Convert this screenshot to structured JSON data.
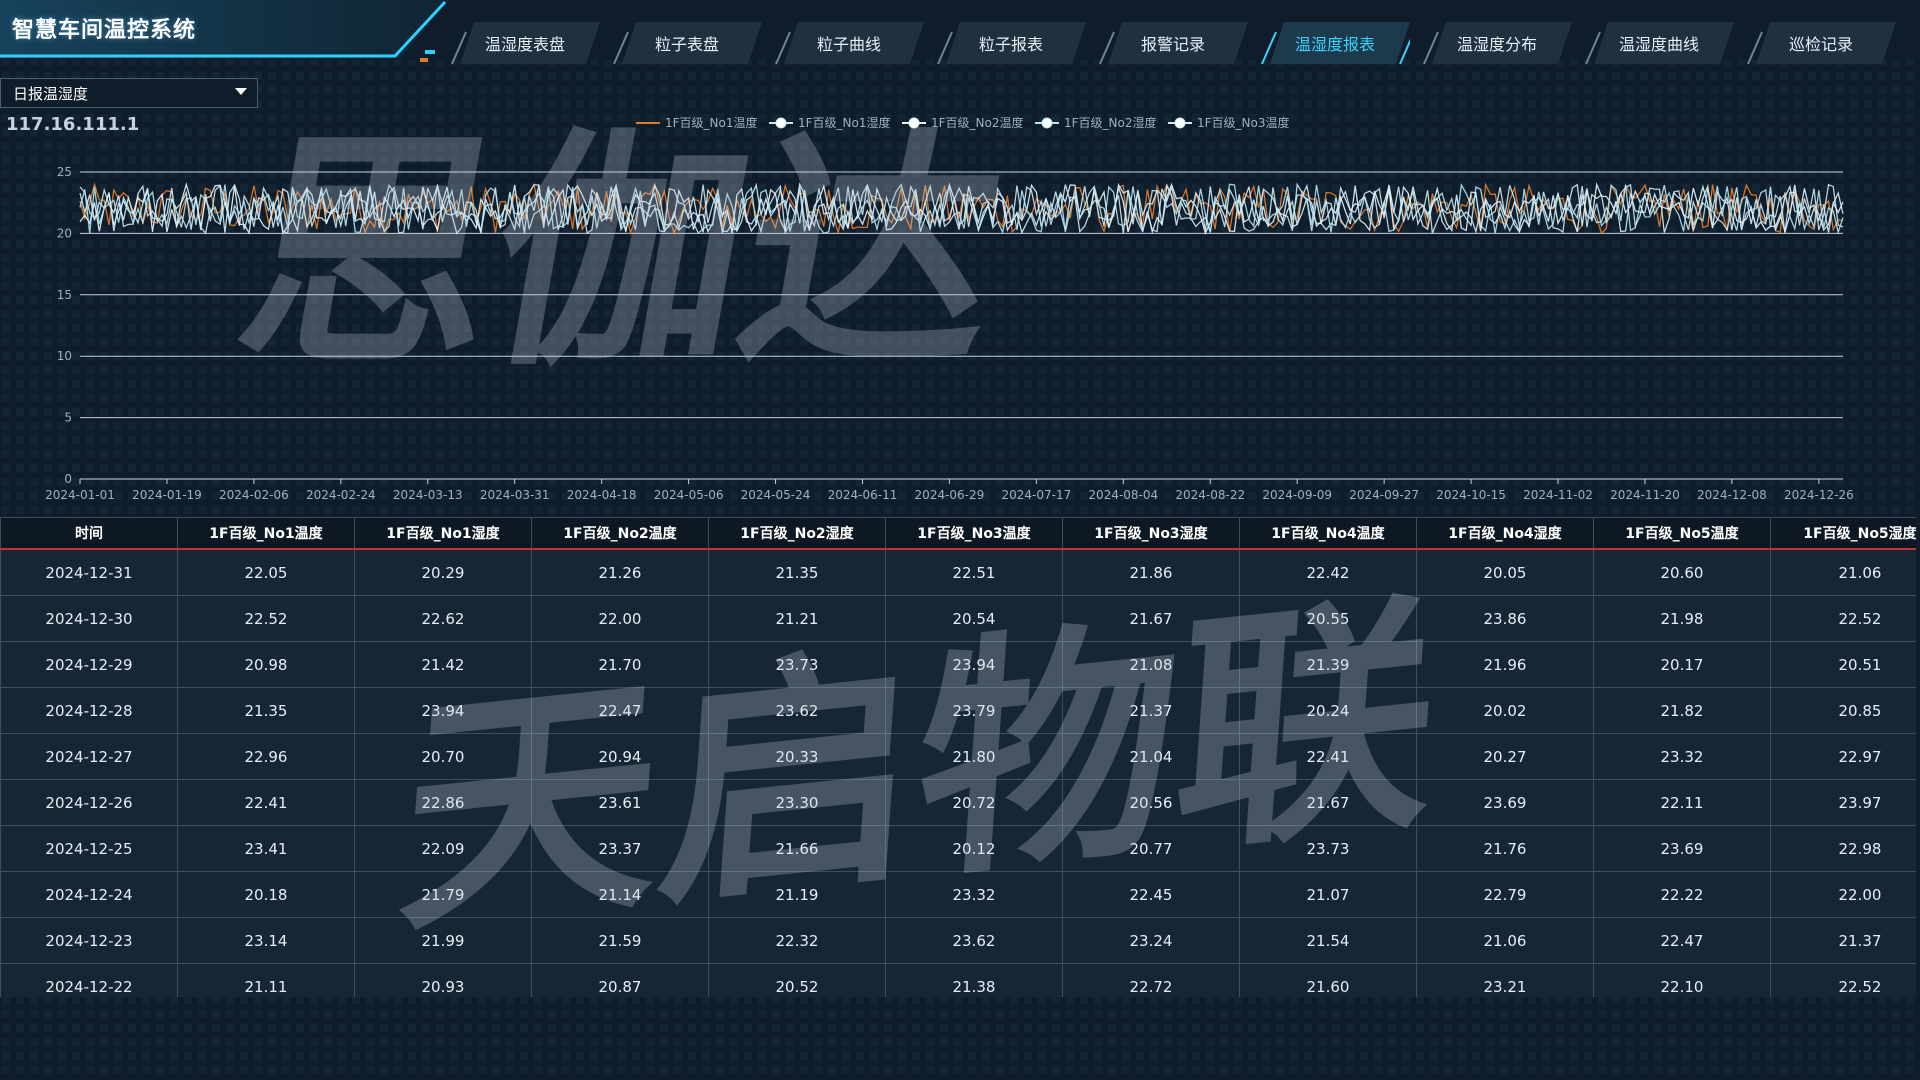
{
  "app": {
    "title": "智慧车间温控系统",
    "ip": "117.16.111.1",
    "accent": "#35d4ff"
  },
  "nav": {
    "items": [
      {
        "label": "温湿度表盘",
        "active": false
      },
      {
        "label": "粒子表盘",
        "active": false
      },
      {
        "label": "粒子曲线",
        "active": false
      },
      {
        "label": "粒子报表",
        "active": false
      },
      {
        "label": "报警记录",
        "active": false
      },
      {
        "label": "温湿度报表",
        "active": true
      },
      {
        "label": "温湿度分布",
        "active": false
      },
      {
        "label": "温湿度曲线",
        "active": false
      },
      {
        "label": "巡检记录",
        "active": false
      }
    ]
  },
  "report_select": {
    "value": "日报温湿度"
  },
  "chart_data": {
    "type": "line",
    "legend_placement": "top-center",
    "grid": true,
    "ylim": [
      0,
      25
    ],
    "yticks": [
      0,
      5,
      10,
      15,
      20,
      25
    ],
    "x_range": [
      "2024-01-01",
      "2024-12-31"
    ],
    "xticks": [
      "2024-01-01",
      "2024-01-19",
      "2024-02-06",
      "2024-02-24",
      "2024-03-13",
      "2024-03-31",
      "2024-04-18",
      "2024-05-06",
      "2024-05-24",
      "2024-06-11",
      "2024-06-29",
      "2024-07-17",
      "2024-08-04",
      "2024-08-22",
      "2024-09-09",
      "2024-09-27",
      "2024-10-15",
      "2024-11-02",
      "2024-11-20",
      "2024-12-08",
      "2024-12-26"
    ],
    "series": [
      {
        "name": "1F百级_No1温度",
        "color": "#e0792a",
        "marker": false,
        "min": 20.0,
        "max": 24.0
      },
      {
        "name": "1F百级_No1湿度",
        "color": "#cde6ee",
        "marker": true,
        "min": 20.0,
        "max": 24.0
      },
      {
        "name": "1F百级_No2温度",
        "color": "#e6f6ff",
        "marker": true,
        "min": 20.0,
        "max": 24.0
      },
      {
        "name": "1F百级_No2湿度",
        "color": "#b4e6f2",
        "marker": true,
        "min": 20.0,
        "max": 24.0
      },
      {
        "name": "1F百级_No3温度",
        "color": "#d2ecf4",
        "marker": true,
        "min": 20.0,
        "max": 24.0
      }
    ]
  },
  "table": {
    "headers": [
      "时间",
      "1F百级_No1温度",
      "1F百级_No1湿度",
      "1F百级_No2温度",
      "1F百级_No2湿度",
      "1F百级_No3温度",
      "1F百级_No3湿度",
      "1F百级_No4温度",
      "1F百级_No4湿度",
      "1F百级_No5温度",
      "1F百级_No5湿度"
    ],
    "rows": [
      [
        "2024-12-31",
        "22.05",
        "20.29",
        "21.26",
        "21.35",
        "22.51",
        "21.86",
        "22.42",
        "20.05",
        "20.60",
        "21.06"
      ],
      [
        "2024-12-30",
        "22.52",
        "22.62",
        "22.00",
        "21.21",
        "20.54",
        "21.67",
        "20.55",
        "23.86",
        "21.98",
        "22.52"
      ],
      [
        "2024-12-29",
        "20.98",
        "21.42",
        "21.70",
        "23.73",
        "23.94",
        "21.08",
        "21.39",
        "21.96",
        "20.17",
        "20.51"
      ],
      [
        "2024-12-28",
        "21.35",
        "23.94",
        "22.47",
        "23.62",
        "23.79",
        "21.37",
        "20.24",
        "20.02",
        "21.82",
        "20.85"
      ],
      [
        "2024-12-27",
        "22.96",
        "20.70",
        "20.94",
        "20.33",
        "21.80",
        "21.04",
        "22.41",
        "20.27",
        "23.32",
        "22.97"
      ],
      [
        "2024-12-26",
        "22.41",
        "22.86",
        "23.61",
        "23.30",
        "20.72",
        "20.56",
        "21.67",
        "23.69",
        "22.11",
        "23.97"
      ],
      [
        "2024-12-25",
        "23.41",
        "22.09",
        "23.37",
        "21.66",
        "20.12",
        "20.77",
        "23.73",
        "21.76",
        "23.69",
        "22.98"
      ],
      [
        "2024-12-24",
        "20.18",
        "21.79",
        "21.14",
        "21.19",
        "23.32",
        "22.45",
        "21.07",
        "22.79",
        "22.22",
        "22.00"
      ],
      [
        "2024-12-23",
        "23.14",
        "21.99",
        "21.59",
        "22.32",
        "23.62",
        "23.24",
        "21.54",
        "21.06",
        "22.47",
        "21.37"
      ],
      [
        "2024-12-22",
        "21.11",
        "20.93",
        "20.87",
        "20.52",
        "21.38",
        "22.72",
        "21.60",
        "23.21",
        "22.10",
        "22.52"
      ]
    ]
  },
  "watermark": {
    "top": "思伽达",
    "bottom": "天启物联"
  }
}
